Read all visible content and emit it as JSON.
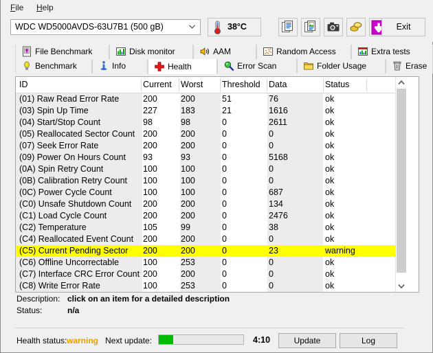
{
  "menu": {
    "items": [
      {
        "label": "File",
        "mnemonic": "F",
        "rest": "ile"
      },
      {
        "label": "Help",
        "mnemonic": "H",
        "rest": "elp"
      }
    ]
  },
  "toolbar": {
    "drive": {
      "value": "WDC WD5000AVDS-63U7B1 (500 gB)",
      "icon": "chevron-down-icon"
    },
    "temperature": {
      "value": "38°C",
      "icon": "thermometer-icon"
    },
    "buttons": [
      {
        "name": "copy-text-button",
        "icon": "copy-text-icon"
      },
      {
        "name": "copy-image-button",
        "icon": "copy-image-icon"
      },
      {
        "name": "screenshot-button",
        "icon": "camera-icon"
      },
      {
        "name": "donate-button",
        "icon": "coins-icon"
      },
      {
        "name": "update-check-button",
        "icon": "down-arrow-icon"
      }
    ],
    "exit_label": "Exit"
  },
  "tabs": {
    "top_row": [
      {
        "label": "File Benchmark",
        "icon": "file-benchmark-icon",
        "selected": false
      },
      {
        "label": "Disk monitor",
        "icon": "bar-chart-icon",
        "selected": false
      },
      {
        "label": "AAM",
        "icon": "speaker-icon",
        "selected": false
      },
      {
        "label": "Random Access",
        "icon": "scatter-icon",
        "selected": false
      },
      {
        "label": "Extra tests",
        "icon": "chart-icon",
        "selected": false
      }
    ],
    "bottom_row": [
      {
        "label": "Benchmark",
        "icon": "lightbulb-icon",
        "selected": false
      },
      {
        "label": "Info",
        "icon": "info-icon",
        "selected": false
      },
      {
        "label": "Health",
        "icon": "red-cross-icon",
        "selected": true
      },
      {
        "label": "Error Scan",
        "icon": "magnifier-icon",
        "selected": false
      },
      {
        "label": "Folder Usage",
        "icon": "folder-icon",
        "selected": false
      },
      {
        "label": "Erase",
        "icon": "trash-icon",
        "selected": false
      }
    ]
  },
  "table": {
    "columns": [
      "ID",
      "Current",
      "Worst",
      "Threshold",
      "Data",
      "Status"
    ],
    "rows": [
      {
        "id": "(01) Raw Read Error Rate",
        "current": "200",
        "worst": "200",
        "threshold": "51",
        "data": "76",
        "status": "ok",
        "highlight": false
      },
      {
        "id": "(03) Spin Up Time",
        "current": "227",
        "worst": "183",
        "threshold": "21",
        "data": "1616",
        "status": "ok",
        "highlight": false
      },
      {
        "id": "(04) Start/Stop Count",
        "current": "98",
        "worst": "98",
        "threshold": "0",
        "data": "2611",
        "status": "ok",
        "highlight": false
      },
      {
        "id": "(05) Reallocated Sector Count",
        "current": "200",
        "worst": "200",
        "threshold": "0",
        "data": "0",
        "status": "ok",
        "highlight": false
      },
      {
        "id": "(07) Seek Error Rate",
        "current": "200",
        "worst": "200",
        "threshold": "0",
        "data": "0",
        "status": "ok",
        "highlight": false
      },
      {
        "id": "(09) Power On Hours Count",
        "current": "93",
        "worst": "93",
        "threshold": "0",
        "data": "5168",
        "status": "ok",
        "highlight": false
      },
      {
        "id": "(0A) Spin Retry Count",
        "current": "100",
        "worst": "100",
        "threshold": "0",
        "data": "0",
        "status": "ok",
        "highlight": false
      },
      {
        "id": "(0B) Calibration Retry Count",
        "current": "100",
        "worst": "100",
        "threshold": "0",
        "data": "0",
        "status": "ok",
        "highlight": false
      },
      {
        "id": "(0C) Power Cycle Count",
        "current": "100",
        "worst": "100",
        "threshold": "0",
        "data": "687",
        "status": "ok",
        "highlight": false
      },
      {
        "id": "(C0) Unsafe Shutdown Count",
        "current": "200",
        "worst": "200",
        "threshold": "0",
        "data": "134",
        "status": "ok",
        "highlight": false
      },
      {
        "id": "(C1) Load Cycle Count",
        "current": "200",
        "worst": "200",
        "threshold": "0",
        "data": "2476",
        "status": "ok",
        "highlight": false
      },
      {
        "id": "(C2) Temperature",
        "current": "105",
        "worst": "99",
        "threshold": "0",
        "data": "38",
        "status": "ok",
        "highlight": false
      },
      {
        "id": "(C4) Reallocated Event Count",
        "current": "200",
        "worst": "200",
        "threshold": "0",
        "data": "0",
        "status": "ok",
        "highlight": false
      },
      {
        "id": "(C5) Current Pending Sector",
        "current": "200",
        "worst": "200",
        "threshold": "0",
        "data": "23",
        "status": "warning",
        "highlight": true
      },
      {
        "id": "(C6) Offline Uncorrectable",
        "current": "100",
        "worst": "253",
        "threshold": "0",
        "data": "0",
        "status": "ok",
        "highlight": false
      },
      {
        "id": "(C7) Interface CRC Error Count",
        "current": "200",
        "worst": "200",
        "threshold": "0",
        "data": "0",
        "status": "ok",
        "highlight": false
      },
      {
        "id": "(C8) Write Error Rate",
        "current": "100",
        "worst": "253",
        "threshold": "0",
        "data": "0",
        "status": "ok",
        "highlight": false
      }
    ]
  },
  "description": {
    "desc_label": "Description:",
    "desc_value": "click on an item for a detailed description",
    "status_label": "Status:",
    "status_value": "n/a"
  },
  "statusbar": {
    "health_label": "Health status:",
    "health_value": "warning",
    "next_update_label": "Next update:",
    "next_update_time": "4:10",
    "progress_percent": 17,
    "update_label": "Update",
    "log_label": "Log"
  },
  "colors": {
    "warning": "#e8a200",
    "highlight_row": "#ffff00",
    "progress": "#00bb00",
    "accent": "#cc00cc"
  }
}
